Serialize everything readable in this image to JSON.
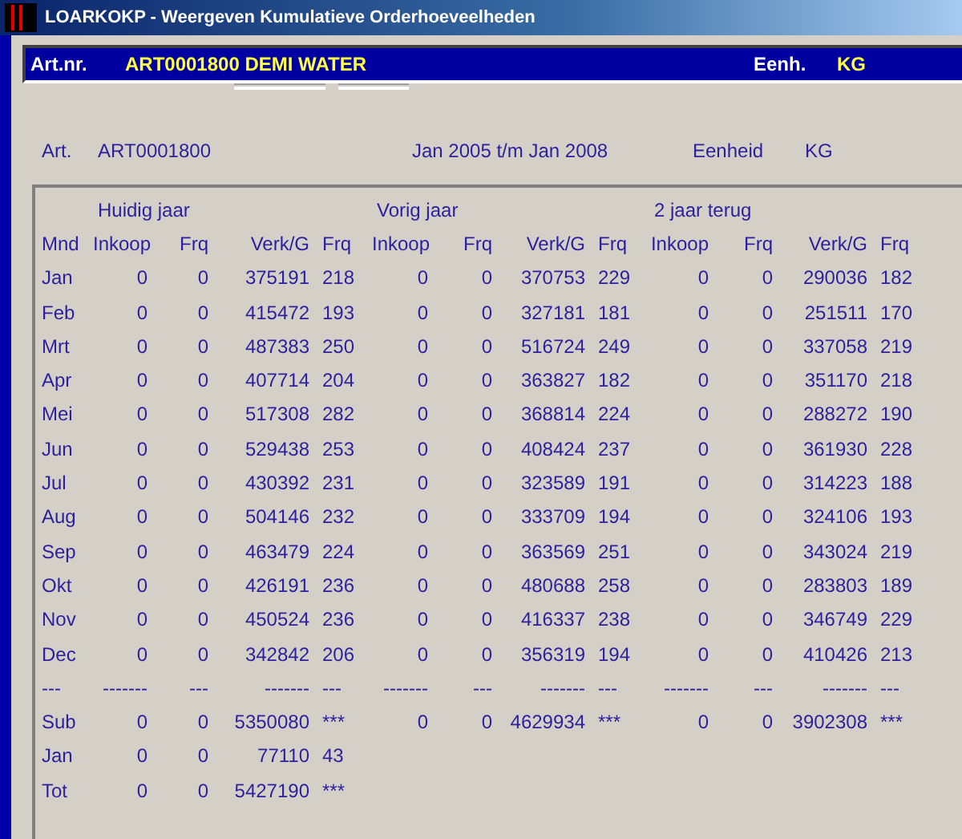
{
  "window": {
    "title": "LOARKOKP - Weergeven Kumulatieve Orderhoeveelheden"
  },
  "header": {
    "article_label": "Art.nr.",
    "article_value": "ART0001800  DEMI WATER",
    "unit_label": "Eenh.",
    "unit_value": "KG"
  },
  "info": {
    "article_label": "Art.",
    "article_value": "ART0001800",
    "period": "Jan 2005 t/m Jan 2008",
    "unit_label": "Eenheid",
    "unit_value": "KG"
  },
  "table": {
    "groups": [
      "Huidig jaar",
      "Vorig jaar",
      "2 jaar terug"
    ],
    "columns": [
      "Mnd",
      "Inkoop",
      "Frq",
      "Verk/G",
      "Frq",
      "Inkoop",
      "Frq",
      "Verk/G",
      "Frq",
      "Inkoop",
      "Frq",
      "Verk/G",
      "Frq"
    ],
    "rows": [
      [
        "Jan",
        "0",
        "0",
        "375191",
        "218",
        "0",
        "0",
        "370753",
        "229",
        "0",
        "0",
        "290036",
        "182"
      ],
      [
        "Feb",
        "0",
        "0",
        "415472",
        "193",
        "0",
        "0",
        "327181",
        "181",
        "0",
        "0",
        "251511",
        "170"
      ],
      [
        "Mrt",
        "0",
        "0",
        "487383",
        "250",
        "0",
        "0",
        "516724",
        "249",
        "0",
        "0",
        "337058",
        "219"
      ],
      [
        "Apr",
        "0",
        "0",
        "407714",
        "204",
        "0",
        "0",
        "363827",
        "182",
        "0",
        "0",
        "351170",
        "218"
      ],
      [
        "Mei",
        "0",
        "0",
        "517308",
        "282",
        "0",
        "0",
        "368814",
        "224",
        "0",
        "0",
        "288272",
        "190"
      ],
      [
        "Jun",
        "0",
        "0",
        "529438",
        "253",
        "0",
        "0",
        "408424",
        "237",
        "0",
        "0",
        "361930",
        "228"
      ],
      [
        "Jul",
        "0",
        "0",
        "430392",
        "231",
        "0",
        "0",
        "323589",
        "191",
        "0",
        "0",
        "314223",
        "188"
      ],
      [
        "Aug",
        "0",
        "0",
        "504146",
        "232",
        "0",
        "0",
        "333709",
        "194",
        "0",
        "0",
        "324106",
        "193"
      ],
      [
        "Sep",
        "0",
        "0",
        "463479",
        "224",
        "0",
        "0",
        "363569",
        "251",
        "0",
        "0",
        "343024",
        "219"
      ],
      [
        "Okt",
        "0",
        "0",
        "426191",
        "236",
        "0",
        "0",
        "480688",
        "258",
        "0",
        "0",
        "283803",
        "189"
      ],
      [
        "Nov",
        "0",
        "0",
        "450524",
        "236",
        "0",
        "0",
        "416337",
        "238",
        "0",
        "0",
        "346749",
        "229"
      ],
      [
        "Dec",
        "0",
        "0",
        "342842",
        "206",
        "0",
        "0",
        "356319",
        "194",
        "0",
        "0",
        "410426",
        "213"
      ],
      [
        "---",
        "-------",
        "---",
        "-------",
        "---",
        "-------",
        "---",
        "-------",
        "---",
        "-------",
        "---",
        "-------",
        "---"
      ],
      [
        "Sub",
        "0",
        "0",
        "5350080",
        "***",
        "0",
        "0",
        "4629934",
        "***",
        "0",
        "0",
        "3902308",
        "***"
      ],
      [
        "Jan",
        "0",
        "0",
        "77110",
        "43"
      ],
      [
        "Tot",
        "0",
        "0",
        "5427190",
        "***"
      ]
    ]
  }
}
